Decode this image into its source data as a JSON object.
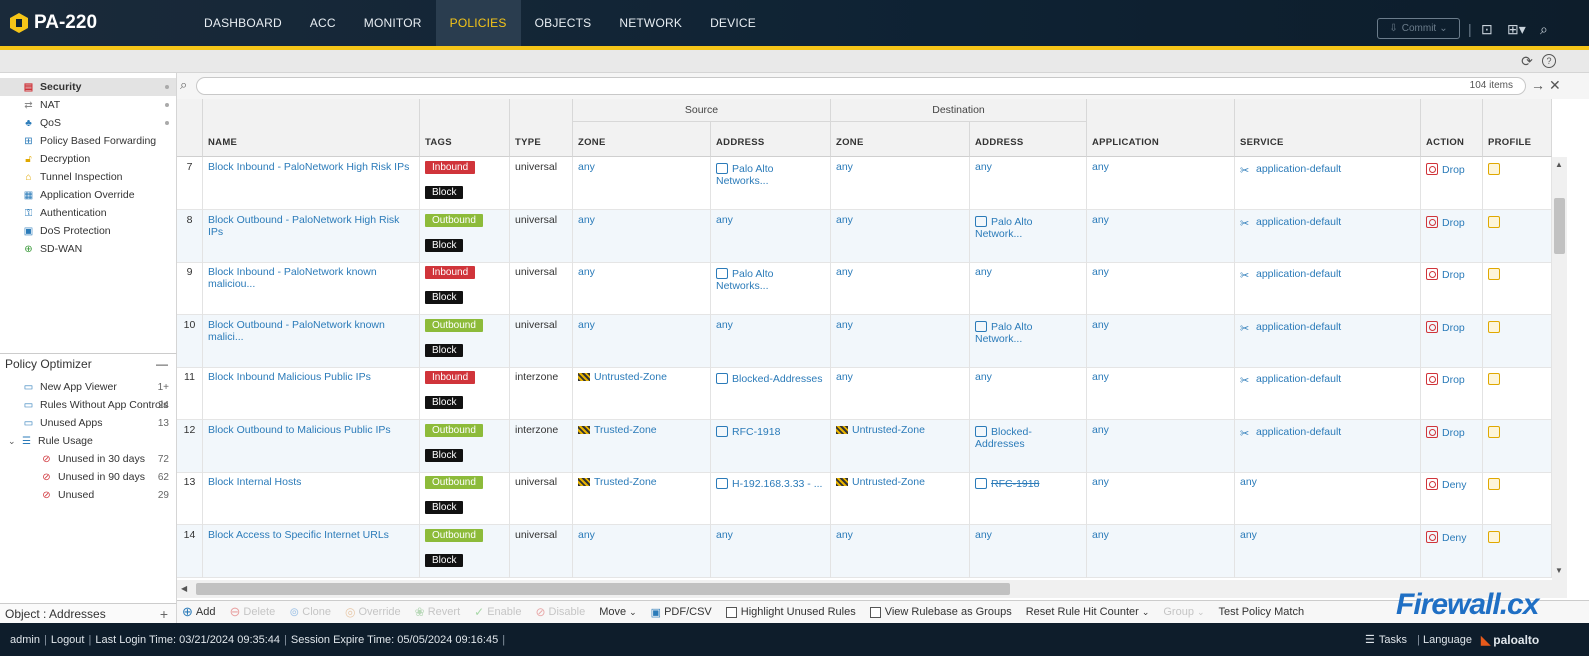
{
  "app": {
    "model": "PA-220"
  },
  "nav": {
    "tabs": [
      "DASHBOARD",
      "ACC",
      "MONITOR",
      "POLICIES",
      "OBJECTS",
      "NETWORK",
      "DEVICE"
    ],
    "active": "POLICIES"
  },
  "commit": {
    "label": "Commit"
  },
  "sidebar": {
    "items": [
      {
        "label": "Security",
        "icon": "security-rule-icon",
        "active": true
      },
      {
        "label": "NAT",
        "icon": "nat-icon"
      },
      {
        "label": "QoS",
        "icon": "qos-icon"
      },
      {
        "label": "Policy Based Forwarding",
        "icon": "pbf-icon"
      },
      {
        "label": "Decryption",
        "icon": "decryption-icon"
      },
      {
        "label": "Tunnel Inspection",
        "icon": "tunnel-icon"
      },
      {
        "label": "Application Override",
        "icon": "app-override-icon"
      },
      {
        "label": "Authentication",
        "icon": "authentication-icon"
      },
      {
        "label": "DoS Protection",
        "icon": "dos-icon"
      },
      {
        "label": "SD-WAN",
        "icon": "sdwan-icon"
      }
    ]
  },
  "optimizer": {
    "title": "Policy Optimizer",
    "items": [
      {
        "label": "New App Viewer",
        "count": "1+"
      },
      {
        "label": "Rules Without App Controls",
        "count": "24"
      },
      {
        "label": "Unused Apps",
        "count": "13"
      },
      {
        "label": "Rule Usage",
        "count": ""
      },
      {
        "label": "Unused in 30 days",
        "count": "72"
      },
      {
        "label": "Unused in 90 days",
        "count": "62"
      },
      {
        "label": "Unused",
        "count": "29"
      }
    ]
  },
  "object_panel": {
    "label": "Object : Addresses"
  },
  "search": {
    "count": "104 items"
  },
  "table": {
    "group_headers": {
      "source": "Source",
      "destination": "Destination"
    },
    "headers": [
      "NAME",
      "TAGS",
      "TYPE",
      "ZONE",
      "ADDRESS",
      "ZONE",
      "ADDRESS",
      "APPLICATION",
      "SERVICE",
      "ACTION",
      "PROFILE"
    ],
    "rows": [
      {
        "num": "7",
        "name": "Block Inbound - PaloNetwork High Risk IPs",
        "tag": "Inbound",
        "tag2": "Block",
        "type": "universal",
        "szone": "any",
        "saddr": "Palo Alto Networks...",
        "dzone": "any",
        "daddr": "any",
        "app": "any",
        "svc": "application-default",
        "action": "Drop"
      },
      {
        "num": "8",
        "name": "Block Outbound - PaloNetwork High Risk IPs",
        "tag": "Outbound",
        "tag2": "Block",
        "type": "universal",
        "szone": "any",
        "saddr": "any",
        "dzone": "any",
        "daddr": "Palo Alto Network...",
        "app": "any",
        "svc": "application-default",
        "action": "Drop"
      },
      {
        "num": "9",
        "name": "Block Inbound - PaloNetwork known maliciou...",
        "tag": "Inbound",
        "tag2": "Block",
        "type": "universal",
        "szone": "any",
        "saddr": "Palo Alto Networks...",
        "dzone": "any",
        "daddr": "any",
        "app": "any",
        "svc": "application-default",
        "action": "Drop"
      },
      {
        "num": "10",
        "name": "Block Outbound - PaloNetwork known malici...",
        "tag": "Outbound",
        "tag2": "Block",
        "type": "universal",
        "szone": "any",
        "saddr": "any",
        "dzone": "any",
        "daddr": "Palo Alto Network...",
        "app": "any",
        "svc": "application-default",
        "action": "Drop"
      },
      {
        "num": "11",
        "name": "Block Inbound Malicious Public IPs",
        "tag": "Inbound",
        "tag2": "Block",
        "type": "interzone",
        "szone": "Untrusted-Zone",
        "saddr": "Blocked-Addresses",
        "dzone": "any",
        "daddr": "any",
        "app": "any",
        "svc": "application-default",
        "action": "Drop"
      },
      {
        "num": "12",
        "name": "Block Outbound to Malicious Public IPs",
        "tag": "Outbound",
        "tag2": "Block",
        "type": "interzone",
        "szone": "Trusted-Zone",
        "saddr": "RFC-1918",
        "dzone": "Untrusted-Zone",
        "daddr": "Blocked-Addresses",
        "app": "any",
        "svc": "application-default",
        "action": "Drop"
      },
      {
        "num": "13",
        "name": "Block Internal Hosts",
        "tag": "Outbound",
        "tag2": "Block",
        "type": "universal",
        "szone": "Trusted-Zone",
        "saddr": "H-192.168.3.33 - ...",
        "dzone": "Untrusted-Zone",
        "daddr": "RFC-1918",
        "app": "any",
        "svc": "any",
        "action": "Deny"
      },
      {
        "num": "14",
        "name": "Block Access to Specific Internet URLs",
        "tag": "Outbound",
        "tag2": "Block",
        "type": "universal",
        "szone": "any",
        "saddr": "any",
        "dzone": "any",
        "daddr": "any",
        "app": "any",
        "svc": "any",
        "action": "Deny"
      }
    ]
  },
  "toolbar": {
    "add": "Add",
    "delete": "Delete",
    "clone": "Clone",
    "override": "Override",
    "revert": "Revert",
    "enable": "Enable",
    "disable": "Disable",
    "move": "Move",
    "pdf": "PDF/CSV",
    "highlight": "Highlight Unused Rules",
    "view_groups": "View Rulebase as Groups",
    "reset": "Reset Rule Hit Counter",
    "group": "Group",
    "test": "Test Policy Match"
  },
  "status": {
    "user": "admin",
    "logout": "Logout",
    "last_login": "Last Login Time: 03/21/2024 09:35:44",
    "session": "Session Expire Time: 05/05/2024 09:16:45",
    "tasks": "Tasks",
    "language": "Language",
    "brand": "paloalto"
  },
  "watermark": "Firewall.cx"
}
